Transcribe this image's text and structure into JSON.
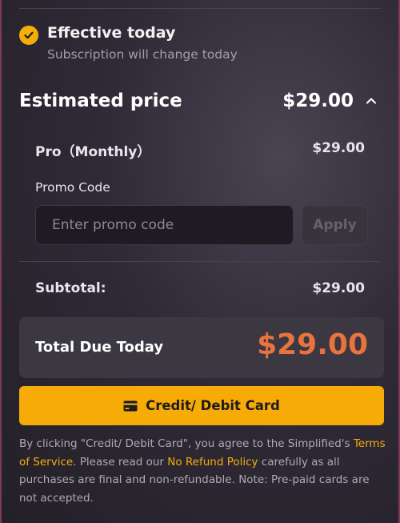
{
  "effective": {
    "title": "Effective today",
    "subtitle": "Subscription will change today"
  },
  "estimate": {
    "label": "Estimated price",
    "price": "$29.00",
    "expanded": true
  },
  "plan": {
    "name": "Pro（Monthly）",
    "price": "$29.00"
  },
  "promo": {
    "label": "Promo Code",
    "placeholder": "Enter promo code",
    "value": "",
    "apply_label": "Apply"
  },
  "subtotal": {
    "label": "Subtotal:",
    "value": "$29.00"
  },
  "total": {
    "label": "Total Due Today",
    "value": "$29.00"
  },
  "payment_button": {
    "label": "Credit/ Debit Card",
    "icon": "credit-card-icon"
  },
  "legal": {
    "part1": "By clicking \"Credit/ Debit Card\", you agree to the Simplified's ",
    "terms_link": "Terms of Service",
    "part2": ". Please read our ",
    "refund_link": "No Refund Policy",
    "part3": " carefully as all purchases are final and non-refundable. Note: Pre-paid cards are not accepted."
  },
  "colors": {
    "accent": "#f7ab07",
    "total_price": "#e8733d",
    "panel_border": "#7a3a5a"
  }
}
